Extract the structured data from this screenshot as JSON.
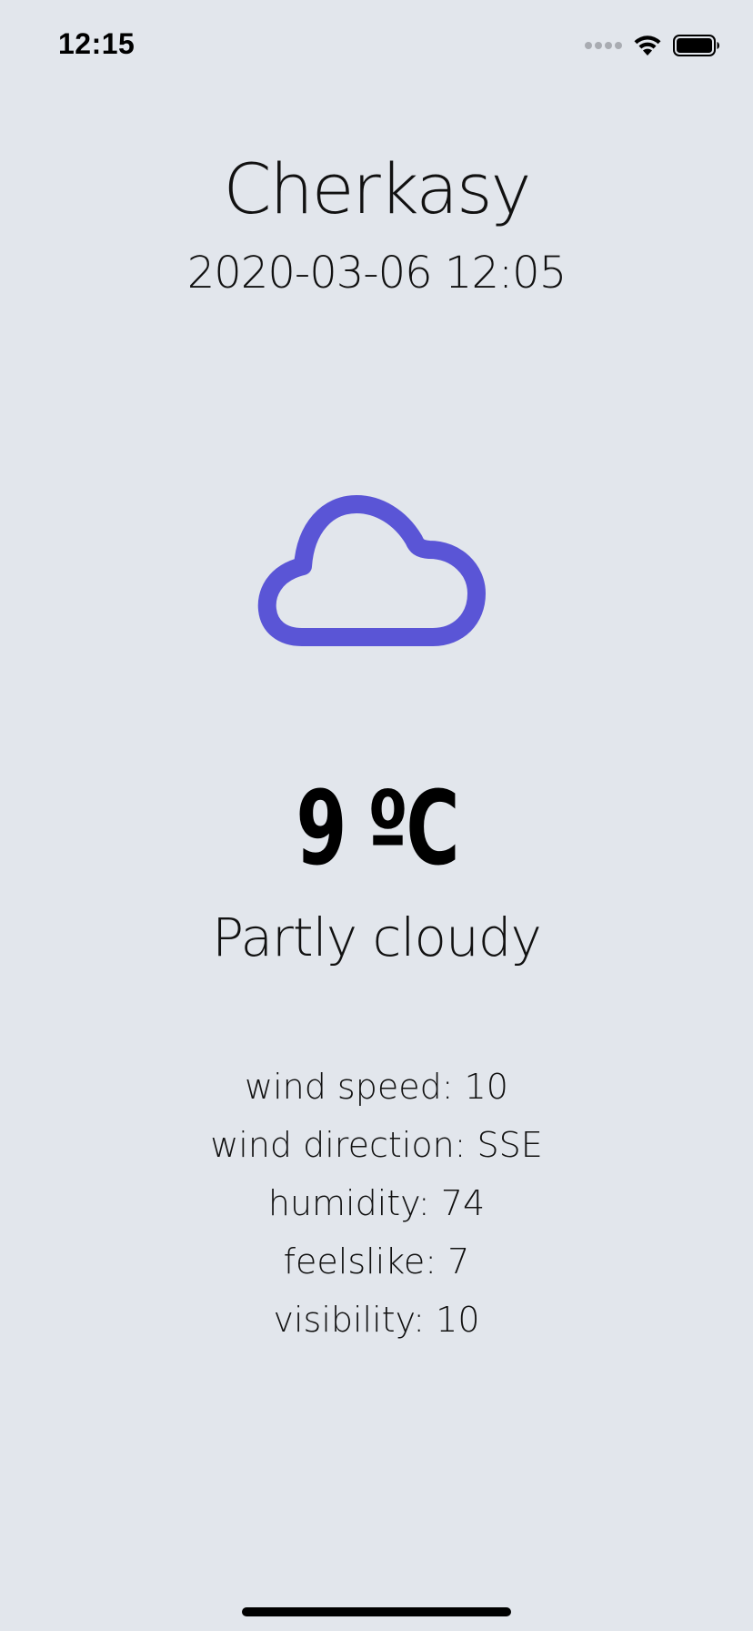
{
  "status_bar": {
    "time": "12:15",
    "icons": [
      "signal-icon",
      "wifi-icon",
      "battery-icon"
    ]
  },
  "weather": {
    "city": "Cherkasy",
    "datetime": "2020-03-06 12:05",
    "icon": "cloud-icon",
    "icon_color": "#5a55d6",
    "temperature": "9 ºC",
    "condition": "Partly cloudy",
    "details": [
      {
        "label": "wind speed: 10"
      },
      {
        "label": "wind direction: SSE"
      },
      {
        "label": "humidity: 74"
      },
      {
        "label": "feelslike: 7"
      },
      {
        "label": "visibility: 10"
      }
    ]
  },
  "colors": {
    "background": "#e2e6ec",
    "text": "#000000"
  }
}
